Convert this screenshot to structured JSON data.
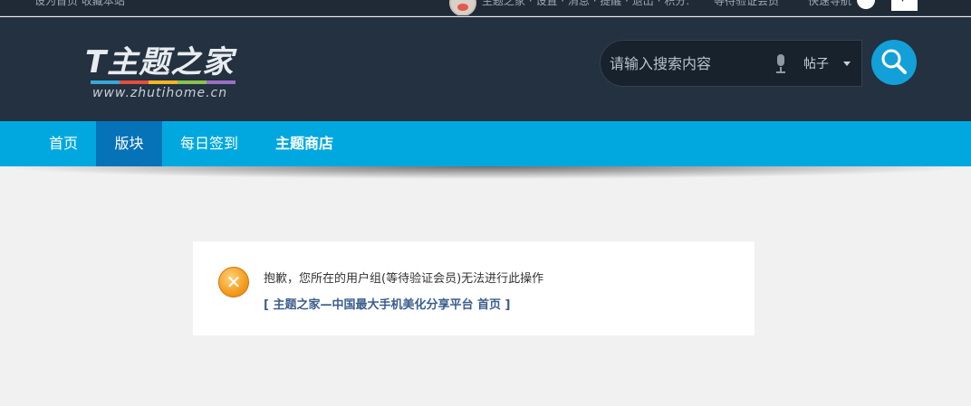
{
  "site": {
    "logo_text": "T主题之家",
    "logo_url": "www.zhutihome.cn",
    "logo_colors": [
      "#3aa7d8",
      "#e44e3e",
      "#f5b523",
      "#8bc34a",
      "#9c6fc4"
    ]
  },
  "topbar": {
    "left_text": "设为首页  收藏本站",
    "user_text": "主题之家 · 设置 · 消息 · 提醒 · 退出 · 积分:",
    "group_text": "等待验证会员",
    "right_text": "快速导航",
    "box_icon": "grid-icon"
  },
  "search": {
    "placeholder": "请输入搜索内容",
    "scope": "帖子",
    "icon": "search-icon"
  },
  "nav": {
    "items": [
      {
        "label": "首页"
      },
      {
        "label": "版块"
      },
      {
        "label": "每日签到"
      },
      {
        "label": "主题商店"
      }
    ],
    "active_index": 1
  },
  "notice": {
    "icon": "close-icon",
    "message": "抱歉，您所在的用户组(等待验证会员)无法进行此操作",
    "link_text": "[ 主题之家—中国最大手机美化分享平台 首页 ]"
  },
  "colors": {
    "header_bg": "#233140",
    "nav_bg": "#01a8df",
    "nav_active": "#0672b8",
    "search_button": "#139fd8",
    "error_orange": "#f39c1e",
    "link": "#3a5d8c"
  }
}
